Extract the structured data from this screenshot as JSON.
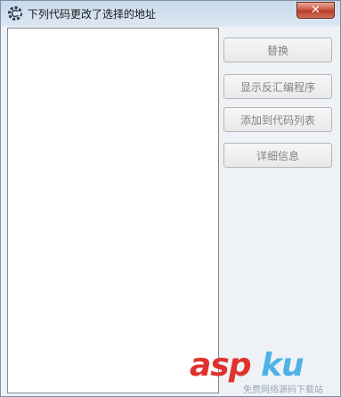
{
  "window": {
    "title": "下列代码更改了选择的地址",
    "close_label": "✕"
  },
  "buttons": {
    "replace": "替换",
    "show_disassembler": "显示反汇编程序",
    "add_to_codelist": "添加到代码列表",
    "details": "详细信息"
  },
  "watermark": {
    "brand_red": "asp",
    "brand_blue": "ku",
    "tagline": "免费网络源码下载站"
  },
  "colors": {
    "close_button": "#c7503a",
    "watermark_red": "#e0322c",
    "watermark_blue": "#4fb2e6"
  },
  "icons": {
    "app": "cheat-engine-gear-icon",
    "close": "close-icon"
  }
}
